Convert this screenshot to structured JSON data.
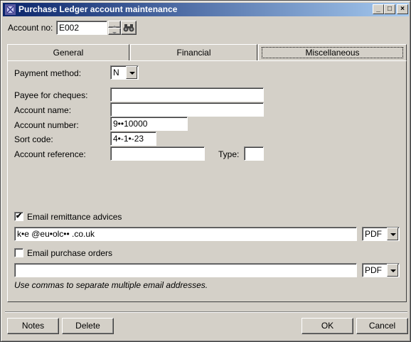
{
  "window": {
    "title": "Purchase Ledger account maintenance",
    "minimize": "_",
    "maximize": "□",
    "close": "×"
  },
  "account": {
    "label": "Account no:",
    "value": "E002"
  },
  "tabs": [
    {
      "label": "General"
    },
    {
      "label": "Financial"
    },
    {
      "label": "Miscellaneous"
    }
  ],
  "misc": {
    "payment_method_label": "Payment method:",
    "payment_method_value": "N",
    "payee_label": "Payee for cheques:",
    "payee_value": "",
    "account_name_label": "Account name:",
    "account_name_value": "",
    "account_number_label": "Account number:",
    "account_number_value": "9••10000",
    "sort_code_label": "Sort code:",
    "sort_code_value": "4•-1•-23",
    "account_reference_label": "Account reference:",
    "account_reference_value": "",
    "type_label": "Type:",
    "type_value": ""
  },
  "email": {
    "remittance_label": "Email remittance advices",
    "remittance_checked": "✔",
    "remittance_address": "k•e @eu•olc•• .co.uk",
    "remittance_format": "PDF",
    "purchase_orders_label": "Email purchase orders",
    "purchase_orders_address": "",
    "purchase_orders_format": "PDF",
    "hint": "Use commas to separate multiple email addresses."
  },
  "buttons": {
    "notes": "Notes",
    "delete": "Delete",
    "ok": "OK",
    "cancel": "Cancel"
  }
}
